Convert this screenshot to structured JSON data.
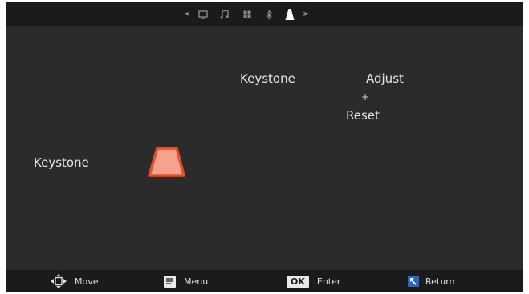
{
  "top_nav": {
    "prev_arrow": "<",
    "next_arrow": ">",
    "tabs": [
      {
        "icon": "monitor-icon",
        "active": false
      },
      {
        "icon": "music-note-icon",
        "active": false
      },
      {
        "icon": "apps-grid-icon",
        "active": false
      },
      {
        "icon": "bluetooth-icon",
        "active": false
      },
      {
        "icon": "keystone-trapezoid-icon",
        "active": true
      }
    ]
  },
  "header": {
    "title": "Keystone",
    "adjust_label": "Adjust",
    "plus_symbol": "+",
    "reset_label": "Reset",
    "minus_symbol": "-"
  },
  "left": {
    "keystone_label": "Keystone",
    "preview_icon": "keystone-preview-icon",
    "preview_colors": {
      "fill": "#f5a38e",
      "stroke": "#e2512b"
    }
  },
  "footer": {
    "move_label": "Move",
    "menu_label": "Menu",
    "ok_label": "OK",
    "enter_label": "Enter",
    "return_label": "Return"
  }
}
